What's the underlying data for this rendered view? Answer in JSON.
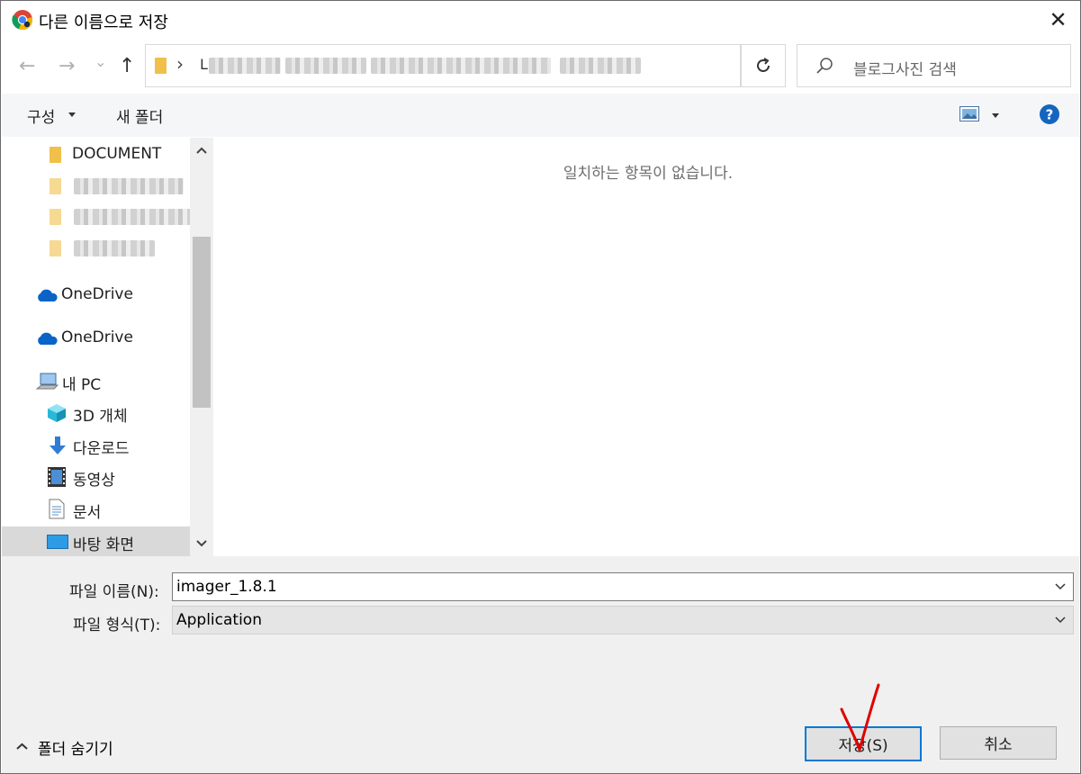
{
  "window": {
    "title": "다른 이름으로 저장",
    "close_glyph": "✕"
  },
  "nav": {
    "back": "←",
    "forward": "→",
    "recent": "⌄",
    "up": "↑",
    "path_sep": "›",
    "path_first_char": "L"
  },
  "search": {
    "placeholder": "블로그사진 검색"
  },
  "toolbar": {
    "organize_label": "구성",
    "new_folder_label": "새 폴더"
  },
  "sidebar": {
    "items": [
      {
        "label": "DOCUMENT"
      },
      {
        "label": "OneDrive"
      },
      {
        "label": "OneDrive"
      },
      {
        "label": "내 PC"
      },
      {
        "label": "3D 개체"
      },
      {
        "label": "다운로드"
      },
      {
        "label": "동영상"
      },
      {
        "label": "문서"
      },
      {
        "label": "바탕 화면"
      }
    ]
  },
  "content": {
    "empty_message": "일치하는 항목이 없습니다."
  },
  "form": {
    "filename_label": "파일 이름(N):",
    "filename_value": "imager_1.8.1",
    "filetype_label": "파일 형식(T):",
    "filetype_value": "Application"
  },
  "footer": {
    "hide_folders_label": "폴더 숨기기",
    "save_label": "저장(S)",
    "cancel_label": "취소"
  },
  "colors": {
    "accent": "#0078d7",
    "annotation": "#e00000",
    "help": "#1565c0"
  }
}
